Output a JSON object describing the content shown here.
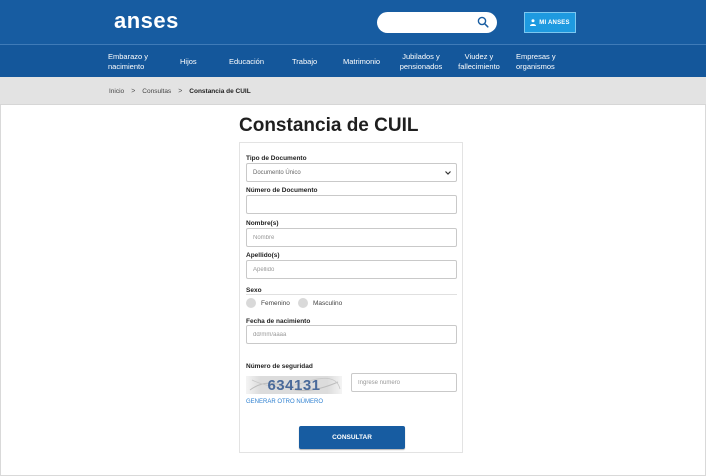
{
  "header": {
    "logo": "anses",
    "search": {
      "placeholder": "",
      "icon": "search-icon"
    },
    "account_button": {
      "label": "MI ANSES",
      "icon": "user-icon"
    }
  },
  "nav": {
    "items": [
      {
        "line1": "Embarazo y",
        "line2": "nacimiento"
      },
      {
        "line1": "Hijos",
        "line2": ""
      },
      {
        "line1": "Educación",
        "line2": ""
      },
      {
        "line1": "Trabajo",
        "line2": ""
      },
      {
        "line1": "Matrimonio",
        "line2": ""
      },
      {
        "line1": "Jubilados y",
        "line2": "pensionados"
      },
      {
        "line1": "Viudez y",
        "line2": "fallecimiento"
      },
      {
        "line1": "Empresas y",
        "line2": "organismos"
      }
    ]
  },
  "breadcrumb": {
    "items": [
      "Inicio",
      "Consultas"
    ],
    "separator": ">",
    "current": "Constancia de CUIL"
  },
  "page": {
    "title": "Constancia de CUIL"
  },
  "form": {
    "tipo_documento": {
      "label": "Tipo de Documento",
      "value": "Documento Único"
    },
    "numero_documento": {
      "label": "Número de Documento",
      "value": "",
      "placeholder": ""
    },
    "nombre": {
      "label": "Nombre(s)",
      "placeholder": "Nombre"
    },
    "apellido": {
      "label": "Apellido(s)",
      "placeholder": "Apellido"
    },
    "sexo": {
      "label": "Sexo",
      "options": [
        "Femenino",
        "Masculino"
      ]
    },
    "fecha_nacimiento": {
      "label": "Fecha de nacimiento",
      "placeholder": "dd/mm/aaaa"
    },
    "seguridad": {
      "label": "Número de seguridad",
      "captcha_text": "634131",
      "input_placeholder": "Ingrese número",
      "regenerate_label": "GENERAR OTRO NÚMERO"
    },
    "submit_label": "CONSULTAR"
  },
  "colors": {
    "header_blue": "#175ca1",
    "nav_blue": "#14579b",
    "account_button": "#1e9ae0",
    "link_blue": "#2f80d0",
    "breadcrumb_bg": "#e3e3e3"
  }
}
